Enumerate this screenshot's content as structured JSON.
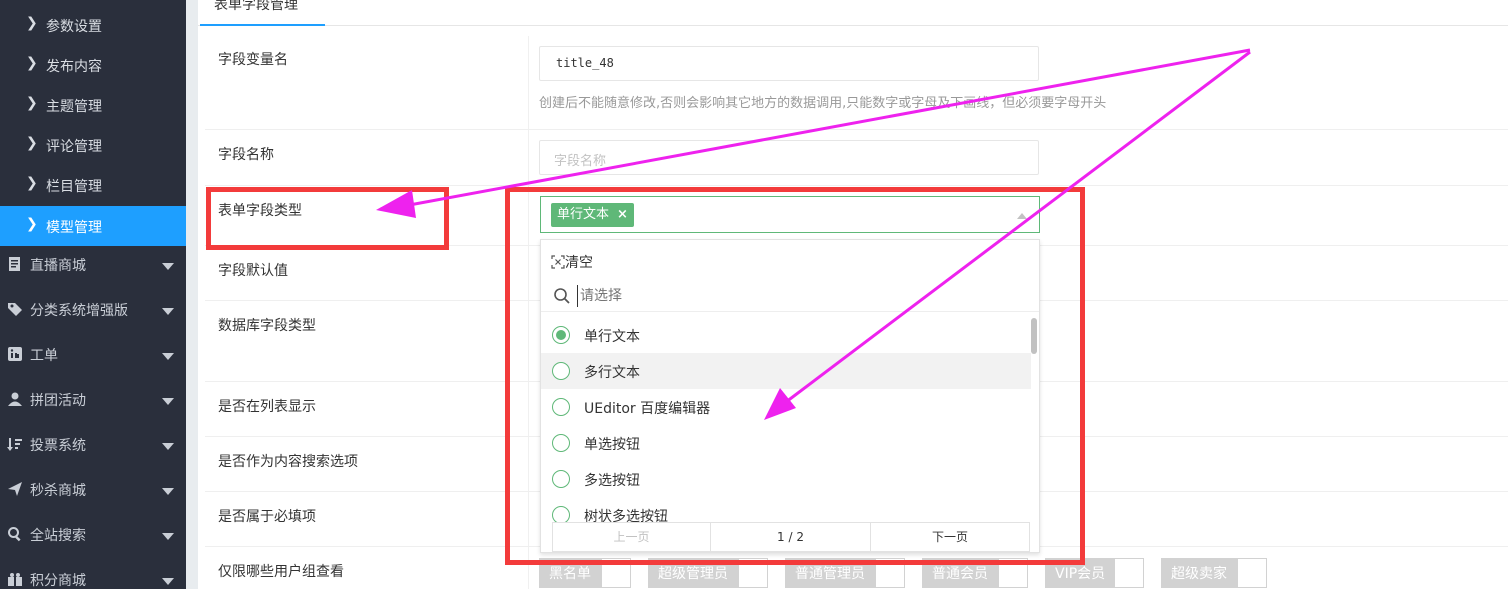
{
  "sidebar": {
    "sub_items": [
      {
        "label": "参数设置"
      },
      {
        "label": "发布内容"
      },
      {
        "label": "主题管理"
      },
      {
        "label": "评论管理"
      },
      {
        "label": "栏目管理"
      },
      {
        "label": "模型管理"
      }
    ],
    "menu_items": [
      {
        "label": "直播商城",
        "icon": "document-icon"
      },
      {
        "label": "分类系统增强版",
        "icon": "tag-icon"
      },
      {
        "label": "工单",
        "icon": "linkedin-icon"
      },
      {
        "label": "拼团活动",
        "icon": "user-icon"
      },
      {
        "label": "投票系统",
        "icon": "sort-icon"
      },
      {
        "label": "秒杀商城",
        "icon": "send-icon"
      },
      {
        "label": "全站搜索",
        "icon": "search-icon"
      },
      {
        "label": "积分商城",
        "icon": "gift-icon"
      }
    ]
  },
  "tabs": {
    "form_field_manage": "表单字段管理"
  },
  "form": {
    "field_var_name": {
      "label": "字段变量名",
      "value": "title_48",
      "hint": "创建后不能随意修改,否则会影响其它地方的数据调用,只能数字或字母及下画线，但必须要字母开头"
    },
    "field_name": {
      "label": "字段名称",
      "placeholder": "字段名称"
    },
    "field_type": {
      "label": "表单字段类型",
      "selected_tag": "单行文本",
      "tag_close": "×"
    },
    "default_value": {
      "label": "字段默认值"
    },
    "db_field_type": {
      "label": "数据库字段类型"
    },
    "show_in_list": {
      "label": "是否在列表显示"
    },
    "search_option": {
      "label": "是否作为内容搜索选项"
    },
    "required": {
      "label": "是否属于必填项"
    },
    "user_groups": {
      "label": "仅限哪些用户组查看",
      "groups": [
        "黑名单",
        "超级管理员",
        "普通管理员",
        "普通会员",
        "VIP会员",
        "超级卖家"
      ]
    }
  },
  "dropdown": {
    "clear_label": "清空",
    "search_placeholder": "请选择",
    "options": [
      "单行文本",
      "多行文本",
      "UEditor 百度编辑器",
      "单选按钮",
      "多选按钮",
      "树状多选按钮"
    ],
    "selected_index": 0,
    "pager": {
      "prev": "上一页",
      "page": "1 / 2",
      "next": "下一页"
    }
  },
  "colors": {
    "sidebar_bg": "#2a2f3c",
    "active_blue": "#1e9fff",
    "green": "#5fb878",
    "annotation_red": "#f33b3b",
    "annotation_magenta": "#ee22ee"
  }
}
